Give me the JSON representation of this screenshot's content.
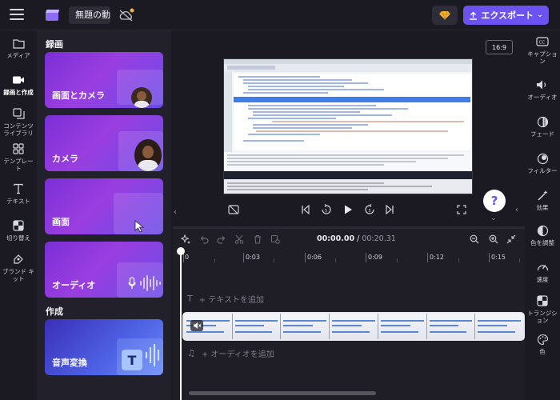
{
  "topbar": {
    "project_title": "無題の動画",
    "export_label": "エクスポート",
    "export_chevron": "⌄"
  },
  "left_rail": {
    "items": [
      {
        "label": "メディア",
        "icon": "folder-icon"
      },
      {
        "label": "録画と作成",
        "icon": "video-camera-icon"
      },
      {
        "label": "コンテンツ\nライブラリ",
        "icon": "library-icon"
      },
      {
        "label": "テンプレー\nト",
        "icon": "templates-icon"
      },
      {
        "label": "テキスト",
        "icon": "text-icon"
      },
      {
        "label": "切り替え",
        "icon": "transition-icon"
      },
      {
        "label": "ブランド キ\nット",
        "icon": "brand-kit-icon"
      }
    ]
  },
  "panel": {
    "section_record": "録画",
    "section_create": "作成",
    "cards": [
      {
        "label": "画面とカメラ"
      },
      {
        "label": "カメラ"
      },
      {
        "label": "画面"
      },
      {
        "label": "オーディオ"
      },
      {
        "label": "音声変換"
      }
    ]
  },
  "preview": {
    "aspect_ratio": "16:9",
    "help_label": "?"
  },
  "right_rail": {
    "items": [
      {
        "label": "キャプショ\nン",
        "icon": "captions-icon"
      },
      {
        "label": "オーディオ",
        "icon": "speaker-icon"
      },
      {
        "label": "フェード",
        "icon": "fade-icon"
      },
      {
        "label": "フィルター",
        "icon": "filter-icon"
      },
      {
        "label": "効果",
        "icon": "effects-wand-icon"
      },
      {
        "label": "色を調整",
        "icon": "color-adjust-icon"
      },
      {
        "label": "速度",
        "icon": "speed-icon"
      },
      {
        "label": "トランジシ\nョン",
        "icon": "transition-icon"
      },
      {
        "label": "色",
        "icon": "palette-icon"
      }
    ]
  },
  "timeline": {
    "current_time": "00:00.00",
    "separator": " / ",
    "total_time": "00:20.31",
    "ticks": [
      "0",
      "0:03",
      "0:06",
      "0:09",
      "0:12",
      "0:15"
    ],
    "add_text_label": "+ テキストを追加",
    "add_audio_label": "+ オーディオを追加"
  }
}
